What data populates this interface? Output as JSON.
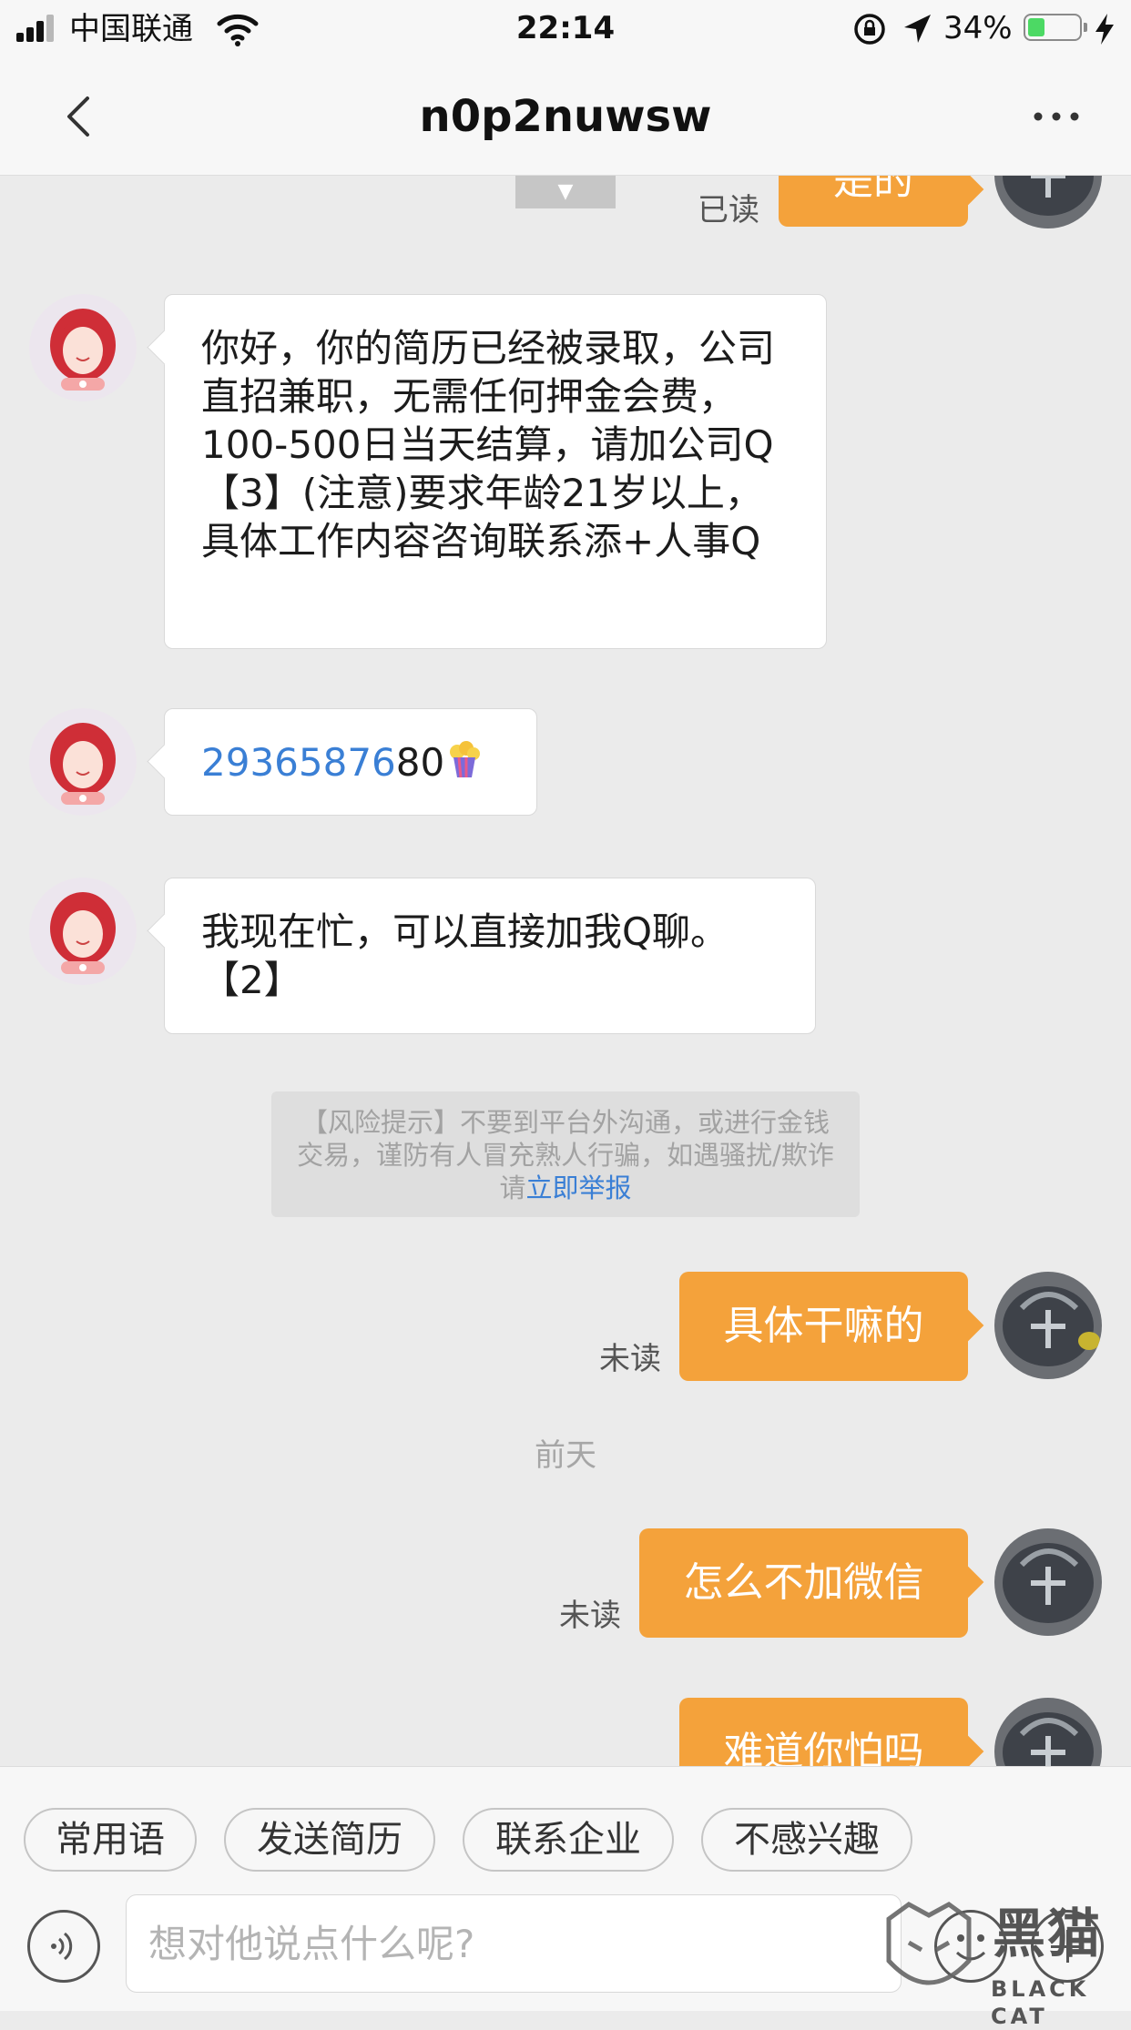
{
  "status_bar": {
    "carrier": "中国联通",
    "time": "22:14",
    "battery_percent": "34%",
    "battery_level": 0.34,
    "icons": [
      "signal-icon",
      "wifi-icon",
      "rotation-lock-icon",
      "location-arrow-icon",
      "battery-icon",
      "charging-bolt-icon"
    ]
  },
  "nav": {
    "title": "n0p2nuwsw",
    "back_icon": "chevron-left-icon",
    "more_icon": "more-dots-icon"
  },
  "chat": {
    "top_partial": {
      "read_status": "已读",
      "text": "是的"
    },
    "messages_in": [
      {
        "text": "你好，你的简历已经被录取，公司直招兼职，无需任何押金会费，100-500日当天结算，请加公司Q【3】(注意)要求年龄21岁以上，具体工作内容咨询联系添+人事Q"
      },
      {
        "phone": "29365876",
        "suffix": "80",
        "emoji": "popcorn-emoji-icon"
      },
      {
        "text": "我现在忙，可以直接加我Q聊。【2】"
      }
    ],
    "risk_notice": {
      "text": "【风险提示】不要到平台外沟通，或进行金钱交易，谨防有人冒充熟人行骗，如遇骚扰/欺诈请",
      "link": "立即举报"
    },
    "messages_out": [
      {
        "text": "具体干嘛的",
        "read_status": "未读"
      },
      {
        "text": "怎么不加微信",
        "read_status": "未读"
      },
      {
        "text": "难道你怕吗"
      }
    ],
    "date_separator": "前天"
  },
  "quick_replies": [
    "常用语",
    "发送简历",
    "联系企业",
    "不感兴趣"
  ],
  "input": {
    "placeholder": "想对他说点什么呢?"
  },
  "watermark": {
    "cn": "黑猫",
    "en": "BLACK CAT"
  },
  "colors": {
    "accent_orange": "#f4a23b",
    "link_blue": "#3a7fd5",
    "background": "#ebebeb"
  }
}
